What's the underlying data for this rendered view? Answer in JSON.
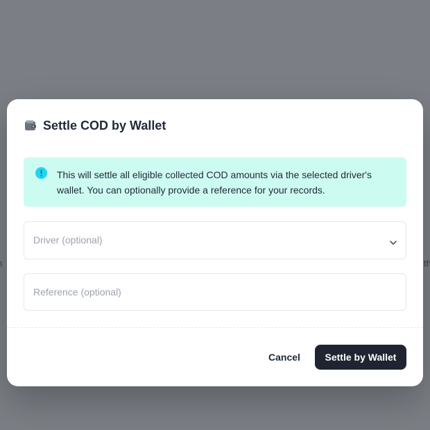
{
  "background": {
    "left_fragment": "n",
    "right_fragment": "th"
  },
  "dialog": {
    "title": "Settle COD by Wallet",
    "title_icon": "wallet-icon",
    "info": {
      "icon": "info-circle-icon",
      "text": "This will settle all eligible collected COD amounts via the selected driver's wallet. You can optionally provide a reference for your records.",
      "color": "#ccfbf1",
      "icon_color": "#22d3ee"
    },
    "driver_select": {
      "placeholder": "Driver (optional)",
      "icon": "chevron-down-icon"
    },
    "reference_input": {
      "placeholder": "Reference (optional)",
      "value": ""
    },
    "cancel_label": "Cancel",
    "submit_label": "Settle by Wallet",
    "submit_color": "#1f2430"
  }
}
